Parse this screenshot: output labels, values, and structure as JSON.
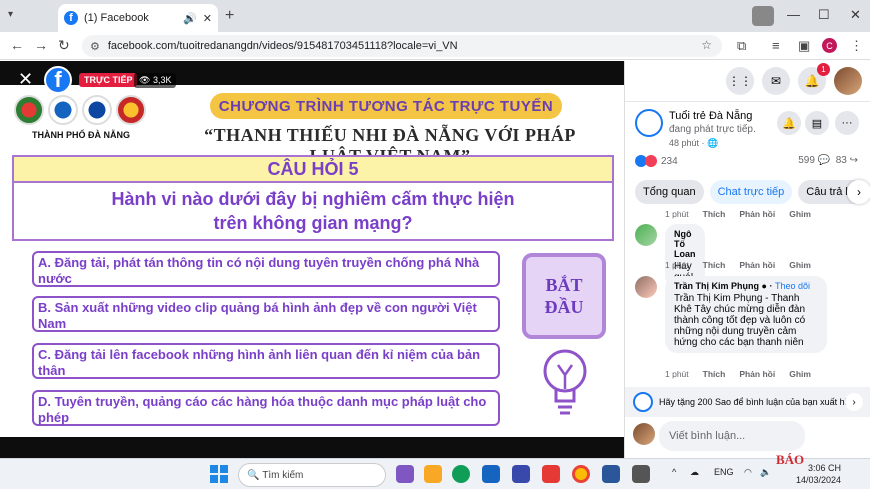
{
  "browser": {
    "tab_title": "(1) Facebook",
    "url": "facebook.com/tuoitredanangdn/videos/915481703451118?locale=vi_VN",
    "profile_letter": "C"
  },
  "video": {
    "live_label": "TRỰC TIẾP",
    "viewers": "3,3K",
    "city_label": "THÀNH PHỐ ĐÀ NẴNG",
    "program_title": "CHƯƠNG TRÌNH TƯƠNG TÁC TRỰC TUYẾN",
    "program_subtitle": "“THANH THIẾU NHI ĐÀ NẴNG VỚI PHÁP LUẬT VIỆT NAM”",
    "question_number": "CÂU HỎI 5",
    "question_line1": "Hành vi nào dưới đây bị nghiêm cấm thực hiện",
    "question_line2": "trên không gian mạng?",
    "options": [
      "A. Đăng tải, phát tán thông tin có nội dung tuyên truyền chống phá Nhà nước",
      "B. Sản xuất những video clip quảng bá hình ảnh đẹp về con người Việt Nam",
      "C. Đăng tải lên facebook những hình ảnh liên quan đến kỉ niệm của bản thân",
      "D. Tuyên truyền, quảng cáo các hàng hóa thuộc danh mục pháp luật cho phép"
    ],
    "start_line1": "BẮT",
    "start_line2": "ĐẦU"
  },
  "panel": {
    "notification_count": "1",
    "page_name": "Tuổi trẻ Đà Nẵng",
    "page_status": "đang phát trực tiếp.",
    "page_time": "48 phút · ",
    "reaction_count": "234",
    "comment_count": "599",
    "share_count": "83",
    "tabs": [
      "Tổng quan",
      "Chat trực tiếp",
      "Câu trả lời"
    ],
    "comments": [
      {
        "name": "Ngô Tố Loan",
        "text": "Hay quá!",
        "time": "1 phút",
        "like": "Thích",
        "reply": "Phản hồi",
        "pin": "Ghim"
      },
      {
        "name": "Trần Thị Kim Phụng",
        "follow": "Theo dõi",
        "text": "Trần Thị Kim Phụng - Thanh Khê Tây chúc mừng diễn đàn thành công tốt đẹp và luôn có những nội dung truyền cảm hứng cho các bạn thanh niên",
        "time": "1 phút",
        "like": "Thích",
        "reply": "Phản hồi",
        "pin": "Ghim"
      }
    ],
    "partial_actions": {
      "time": "1 phút",
      "like": "Thích",
      "reply": "Phản hồi",
      "pin": "Ghim"
    },
    "gift_text": "Hãy tặng 200 Sao để bình luận của bạn xuất hiện",
    "composer_placeholder": "Viết bình luận..."
  },
  "taskbar": {
    "search_placeholder": "Tìm kiếm",
    "lang": "ENG",
    "time": "3:06 CH",
    "date": "14/03/2024",
    "watermark": "BÁO"
  }
}
